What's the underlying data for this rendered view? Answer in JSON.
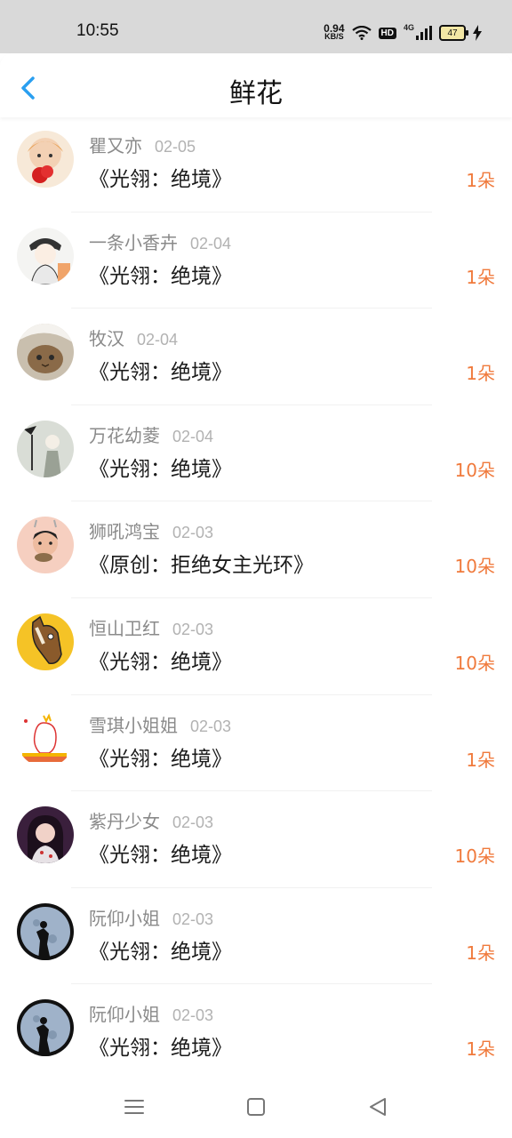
{
  "status_bar": {
    "time": "10:55",
    "net_speed_value": "0.94",
    "net_speed_unit": "KB/S",
    "hd": "HD",
    "network": "4G",
    "battery": "47"
  },
  "header": {
    "title": "鲜花",
    "back_icon": "chevron-left-icon"
  },
  "colors": {
    "accent": "#2a9ff0",
    "count": "#f07a3c",
    "name": "#8a8a8a",
    "date": "#b2b2b2"
  },
  "items": [
    {
      "name": "瞿又亦",
      "date": "02-05",
      "book": "《光翎：绝境》",
      "count": "1朵"
    },
    {
      "name": "一条小香卉",
      "date": "02-04",
      "book": "《光翎：绝境》",
      "count": "1朵"
    },
    {
      "name": "牧汉",
      "date": "02-04",
      "book": "《光翎：绝境》",
      "count": "1朵"
    },
    {
      "name": "万花幼菱",
      "date": "02-04",
      "book": "《光翎：绝境》",
      "count": "10朵"
    },
    {
      "name": "狮吼鸿宝",
      "date": "02-03",
      "book": "《原创：拒绝女主光环》",
      "count": "10朵"
    },
    {
      "name": "恒山卫红",
      "date": "02-03",
      "book": "《光翎：绝境》",
      "count": "10朵"
    },
    {
      "name": "雪琪小姐姐",
      "date": "02-03",
      "book": "《光翎：绝境》",
      "count": "1朵"
    },
    {
      "name": "紫丹少女",
      "date": "02-03",
      "book": "《光翎：绝境》",
      "count": "10朵"
    },
    {
      "name": "阮仰小姐",
      "date": "02-03",
      "book": "《光翎：绝境》",
      "count": "1朵"
    },
    {
      "name": "阮仰小姐",
      "date": "02-03",
      "book": "《光翎：绝境》",
      "count": "1朵"
    }
  ],
  "navbar": {
    "menu_icon": "menu-icon",
    "home_icon": "home-square-icon",
    "back_icon": "back-triangle-icon"
  }
}
